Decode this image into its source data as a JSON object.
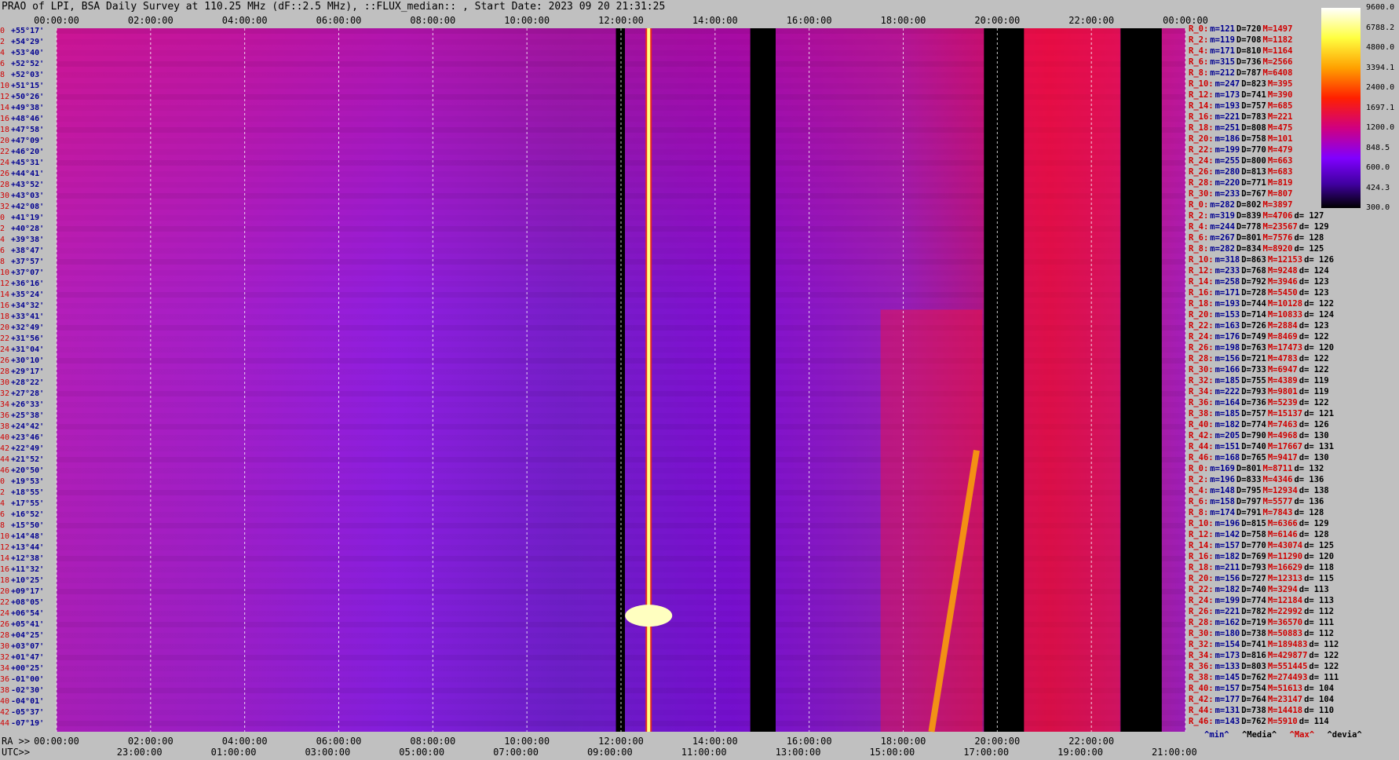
{
  "title": "PRAO of LPI, BSA Daily Survey at 110.25 MHz (dF::2.5 MHz), ::FLUX_median:: , Start Date: 2023 09 20 21:31:25",
  "chart_data": {
    "type": "heatmap",
    "title": "PRAO of LPI, BSA Daily Survey at 110.25 MHz (dF::2.5 MHz), ::FLUX_median:: , Start Date: 2023 09 20 21:31:25",
    "top_axis_ticks": [
      "00:00:00",
      "02:00:00",
      "04:00:00",
      "06:00:00",
      "08:00:00",
      "10:00:00",
      "12:00:00",
      "14:00:00",
      "16:00:00",
      "18:00:00",
      "20:00:00",
      "22:00:00",
      "00:00:00"
    ],
    "bottom_ra_prefix": "RA >>",
    "bottom_ra_ticks": [
      "00:00:00",
      "02:00:00",
      "04:00:00",
      "06:00:00",
      "08:00:00",
      "10:00:00",
      "12:00:00",
      "14:00:00",
      "16:00:00",
      "18:00:00",
      "20:00:00",
      "22:00:00"
    ],
    "bottom_utc_prefix": "UTC>>",
    "bottom_utc_ticks": [
      "23:00:00",
      "01:00:00",
      "03:00:00",
      "05:00:00",
      "07:00:00",
      "09:00:00",
      "11:00:00",
      "13:00:00",
      "15:00:00",
      "17:00:00",
      "19:00:00",
      "21:00:00"
    ],
    "colorbar_ticks": [
      "9600.0",
      "6788.2",
      "4800.0",
      "3394.1",
      "2400.0",
      "1697.1",
      "1200.0",
      "848.5",
      "600.0",
      "424.3",
      "300.0"
    ],
    "rows": [
      {
        "idx": "0",
        "dec": "+55°17'"
      },
      {
        "idx": "2",
        "dec": "+54°29'"
      },
      {
        "idx": "4",
        "dec": "+53°40'"
      },
      {
        "idx": "6",
        "dec": "+52°52'"
      },
      {
        "idx": "8",
        "dec": "+52°03'"
      },
      {
        "idx": "10",
        "dec": "+51°15'"
      },
      {
        "idx": "12",
        "dec": "+50°26'"
      },
      {
        "idx": "14",
        "dec": "+49°38'"
      },
      {
        "idx": "16",
        "dec": "+48°46'"
      },
      {
        "idx": "18",
        "dec": "+47°58'"
      },
      {
        "idx": "20",
        "dec": "+47°09'"
      },
      {
        "idx": "22",
        "dec": "+46°20'"
      },
      {
        "idx": "24",
        "dec": "+45°31'"
      },
      {
        "idx": "26",
        "dec": "+44°41'"
      },
      {
        "idx": "28",
        "dec": "+43°52'"
      },
      {
        "idx": "30",
        "dec": "+43°03'"
      },
      {
        "idx": "32",
        "dec": "+42°08'"
      },
      {
        "idx": "0",
        "dec": "+41°19'"
      },
      {
        "idx": "2",
        "dec": "+40°28'"
      },
      {
        "idx": "4",
        "dec": "+39°38'"
      },
      {
        "idx": "6",
        "dec": "+38°47'"
      },
      {
        "idx": "8",
        "dec": "+37°57'"
      },
      {
        "idx": "10",
        "dec": "+37°07'"
      },
      {
        "idx": "12",
        "dec": "+36°16'"
      },
      {
        "idx": "14",
        "dec": "+35°24'"
      },
      {
        "idx": "16",
        "dec": "+34°32'"
      },
      {
        "idx": "18",
        "dec": "+33°41'"
      },
      {
        "idx": "20",
        "dec": "+32°49'"
      },
      {
        "idx": "22",
        "dec": "+31°56'"
      },
      {
        "idx": "24",
        "dec": "+31°04'"
      },
      {
        "idx": "26",
        "dec": "+30°10'"
      },
      {
        "idx": "28",
        "dec": "+29°17'"
      },
      {
        "idx": "30",
        "dec": "+28°22'"
      },
      {
        "idx": "32",
        "dec": "+27°28'"
      },
      {
        "idx": "34",
        "dec": "+26°33'"
      },
      {
        "idx": "36",
        "dec": "+25°38'"
      },
      {
        "idx": "38",
        "dec": "+24°42'"
      },
      {
        "idx": "40",
        "dec": "+23°46'"
      },
      {
        "idx": "42",
        "dec": "+22°49'"
      },
      {
        "idx": "44",
        "dec": "+21°52'"
      },
      {
        "idx": "46",
        "dec": "+20°50'"
      },
      {
        "idx": "0",
        "dec": "+19°53'"
      },
      {
        "idx": "2",
        "dec": "+18°55'"
      },
      {
        "idx": "4",
        "dec": "+17°55'"
      },
      {
        "idx": "6",
        "dec": "+16°52'"
      },
      {
        "idx": "8",
        "dec": "+15°50'"
      },
      {
        "idx": "10",
        "dec": "+14°48'"
      },
      {
        "idx": "12",
        "dec": "+13°44'"
      },
      {
        "idx": "14",
        "dec": "+12°38'"
      },
      {
        "idx": "16",
        "dec": "+11°32'"
      },
      {
        "idx": "18",
        "dec": "+10°25'"
      },
      {
        "idx": "20",
        "dec": "+09°17'"
      },
      {
        "idx": "22",
        "dec": "+08°05'"
      },
      {
        "idx": "24",
        "dec": "+06°54'"
      },
      {
        "idx": "26",
        "dec": "+05°41'"
      },
      {
        "idx": "28",
        "dec": "+04°25'"
      },
      {
        "idx": "30",
        "dec": "+03°07'"
      },
      {
        "idx": "32",
        "dec": "+01°47'"
      },
      {
        "idx": "34",
        "dec": "+00°25'"
      },
      {
        "idx": "36",
        "dec": "-01°00'"
      },
      {
        "idx": "38",
        "dec": "-02°30'"
      },
      {
        "idx": "40",
        "dec": "-04°01'"
      },
      {
        "idx": "42",
        "dec": "-05°37'"
      },
      {
        "idx": "44",
        "dec": "-07°19'"
      }
    ],
    "stats": [
      {
        "name": "R_0:",
        "min": "m=121",
        "med": "D=720",
        "max": "M=1497",
        "dev": ""
      },
      {
        "name": "R_2:",
        "min": "m=119",
        "med": "D=708",
        "max": "M=1182",
        "dev": ""
      },
      {
        "name": "R_4:",
        "min": "m=171",
        "med": "D=810",
        "max": "M=1164",
        "dev": ""
      },
      {
        "name": "R_6:",
        "min": "m=315",
        "med": "D=736",
        "max": "M=2566",
        "dev": ""
      },
      {
        "name": "R_8:",
        "min": "m=212",
        "med": "D=787",
        "max": "M=6408",
        "dev": ""
      },
      {
        "name": "R_10:",
        "min": "m=247",
        "med": "D=823",
        "max": "M=395",
        "dev": ""
      },
      {
        "name": "R_12:",
        "min": "m=173",
        "med": "D=741",
        "max": "M=390",
        "dev": ""
      },
      {
        "name": "R_14:",
        "min": "m=193",
        "med": "D=757",
        "max": "M=685",
        "dev": ""
      },
      {
        "name": "R_16:",
        "min": "m=221",
        "med": "D=783",
        "max": "M=221",
        "dev": ""
      },
      {
        "name": "R_18:",
        "min": "m=251",
        "med": "D=808",
        "max": "M=475",
        "dev": ""
      },
      {
        "name": "R_20:",
        "min": "m=186",
        "med": "D=758",
        "max": "M=101",
        "dev": ""
      },
      {
        "name": "R_22:",
        "min": "m=199",
        "med": "D=770",
        "max": "M=479",
        "dev": ""
      },
      {
        "name": "R_24:",
        "min": "m=255",
        "med": "D=800",
        "max": "M=663",
        "dev": ""
      },
      {
        "name": "R_26:",
        "min": "m=280",
        "med": "D=813",
        "max": "M=683",
        "dev": ""
      },
      {
        "name": "R_28:",
        "min": "m=220",
        "med": "D=771",
        "max": "M=819",
        "dev": ""
      },
      {
        "name": "R_30:",
        "min": "m=233",
        "med": "D=767",
        "max": "M=807",
        "dev": ""
      },
      {
        "name": "R_0:",
        "min": "m=282",
        "med": "D=802",
        "max": "M=3897",
        "dev": ""
      },
      {
        "name": "R_2:",
        "min": "m=319",
        "med": "D=839",
        "max": "M=4706",
        "dev": "d= 127"
      },
      {
        "name": "R_4:",
        "min": "m=244",
        "med": "D=778",
        "max": "M=23567",
        "dev": "d= 129"
      },
      {
        "name": "R_6:",
        "min": "m=267",
        "med": "D=801",
        "max": "M=7576",
        "dev": "d= 128"
      },
      {
        "name": "R_8:",
        "min": "m=282",
        "med": "D=834",
        "max": "M=8920",
        "dev": "d= 125"
      },
      {
        "name": "R_10:",
        "min": "m=318",
        "med": "D=863",
        "max": "M=12153",
        "dev": "d= 126"
      },
      {
        "name": "R_12:",
        "min": "m=233",
        "med": "D=768",
        "max": "M=9248",
        "dev": "d= 124"
      },
      {
        "name": "R_14:",
        "min": "m=258",
        "med": "D=792",
        "max": "M=3946",
        "dev": "d= 123"
      },
      {
        "name": "R_16:",
        "min": "m=171",
        "med": "D=728",
        "max": "M=5450",
        "dev": "d= 123"
      },
      {
        "name": "R_18:",
        "min": "m=193",
        "med": "D=744",
        "max": "M=10128",
        "dev": "d= 122"
      },
      {
        "name": "R_20:",
        "min": "m=153",
        "med": "D=714",
        "max": "M=10833",
        "dev": "d= 124"
      },
      {
        "name": "R_22:",
        "min": "m=163",
        "med": "D=726",
        "max": "M=2884",
        "dev": "d= 123"
      },
      {
        "name": "R_24:",
        "min": "m=176",
        "med": "D=749",
        "max": "M=8469",
        "dev": "d= 122"
      },
      {
        "name": "R_26:",
        "min": "m=198",
        "med": "D=763",
        "max": "M=17473",
        "dev": "d= 120"
      },
      {
        "name": "R_28:",
        "min": "m=156",
        "med": "D=721",
        "max": "M=4783",
        "dev": "d= 122"
      },
      {
        "name": "R_30:",
        "min": "m=166",
        "med": "D=733",
        "max": "M=6947",
        "dev": "d= 122"
      },
      {
        "name": "R_32:",
        "min": "m=185",
        "med": "D=755",
        "max": "M=4389",
        "dev": "d= 119"
      },
      {
        "name": "R_34:",
        "min": "m=222",
        "med": "D=793",
        "max": "M=9801",
        "dev": "d= 119"
      },
      {
        "name": "R_36:",
        "min": "m=164",
        "med": "D=736",
        "max": "M=5239",
        "dev": "d= 122"
      },
      {
        "name": "R_38:",
        "min": "m=185",
        "med": "D=757",
        "max": "M=15137",
        "dev": "d= 121"
      },
      {
        "name": "R_40:",
        "min": "m=182",
        "med": "D=774",
        "max": "M=7463",
        "dev": "d= 126"
      },
      {
        "name": "R_42:",
        "min": "m=205",
        "med": "D=790",
        "max": "M=4968",
        "dev": "d= 130"
      },
      {
        "name": "R_44:",
        "min": "m=151",
        "med": "D=740",
        "max": "M=17667",
        "dev": "d= 131"
      },
      {
        "name": "R_46:",
        "min": "m=168",
        "med": "D=765",
        "max": "M=9417",
        "dev": "d= 130"
      },
      {
        "name": "R_0:",
        "min": "m=169",
        "med": "D=801",
        "max": "M=8711",
        "dev": "d= 132"
      },
      {
        "name": "R_2:",
        "min": "m=196",
        "med": "D=833",
        "max": "M=4346",
        "dev": "d= 136"
      },
      {
        "name": "R_4:",
        "min": "m=148",
        "med": "D=795",
        "max": "M=12934",
        "dev": "d= 138"
      },
      {
        "name": "R_6:",
        "min": "m=158",
        "med": "D=797",
        "max": "M=5577",
        "dev": "d= 136"
      },
      {
        "name": "R_8:",
        "min": "m=174",
        "med": "D=791",
        "max": "M=7843",
        "dev": "d= 128"
      },
      {
        "name": "R_10:",
        "min": "m=196",
        "med": "D=815",
        "max": "M=6366",
        "dev": "d= 129"
      },
      {
        "name": "R_12:",
        "min": "m=142",
        "med": "D=758",
        "max": "M=6146",
        "dev": "d= 128"
      },
      {
        "name": "R_14:",
        "min": "m=157",
        "med": "D=770",
        "max": "M=43074",
        "dev": "d= 125"
      },
      {
        "name": "R_16:",
        "min": "m=182",
        "med": "D=769",
        "max": "M=11290",
        "dev": "d= 120"
      },
      {
        "name": "R_18:",
        "min": "m=211",
        "med": "D=793",
        "max": "M=16629",
        "dev": "d= 118"
      },
      {
        "name": "R_20:",
        "min": "m=156",
        "med": "D=727",
        "max": "M=12313",
        "dev": "d= 115"
      },
      {
        "name": "R_22:",
        "min": "m=182",
        "med": "D=740",
        "max": "M=3294",
        "dev": "d= 113"
      },
      {
        "name": "R_24:",
        "min": "m=199",
        "med": "D=774",
        "max": "M=12184",
        "dev": "d= 113"
      },
      {
        "name": "R_26:",
        "min": "m=221",
        "med": "D=782",
        "max": "M=22992",
        "dev": "d= 112"
      },
      {
        "name": "R_28:",
        "min": "m=162",
        "med": "D=719",
        "max": "M=36570",
        "dev": "d= 111"
      },
      {
        "name": "R_30:",
        "min": "m=180",
        "med": "D=738",
        "max": "M=50883",
        "dev": "d= 112"
      },
      {
        "name": "R_32:",
        "min": "m=154",
        "med": "D=741",
        "max": "M=189483",
        "dev": "d= 112"
      },
      {
        "name": "R_34:",
        "min": "m=173",
        "med": "D=816",
        "max": "M=429877",
        "dev": "d= 122"
      },
      {
        "name": "R_36:",
        "min": "m=133",
        "med": "D=803",
        "max": "M=551445",
        "dev": "d= 122"
      },
      {
        "name": "R_38:",
        "min": "m=145",
        "med": "D=762",
        "max": "M=274493",
        "dev": "d= 111"
      },
      {
        "name": "R_40:",
        "min": "m=157",
        "med": "D=754",
        "max": "M=51613",
        "dev": "d= 104"
      },
      {
        "name": "R_42:",
        "min": "m=177",
        "med": "D=764",
        "max": "M=23147",
        "dev": "d= 104"
      },
      {
        "name": "R_44:",
        "min": "m=131",
        "med": "D=738",
        "max": "M=14418",
        "dev": "d= 110"
      },
      {
        "name": "R_46:",
        "min": "m=143",
        "med": "D=762",
        "max": "M=5910",
        "dev": "d= 114"
      }
    ],
    "legend": {
      "min": "^min^",
      "median": "^Media^",
      "max": "^Max^",
      "dev": "^devia^"
    },
    "colors": {
      "background": "#8a2be2",
      "bright": "#ffff80",
      "hot": "#ff2000",
      "gap": "#000000"
    }
  }
}
